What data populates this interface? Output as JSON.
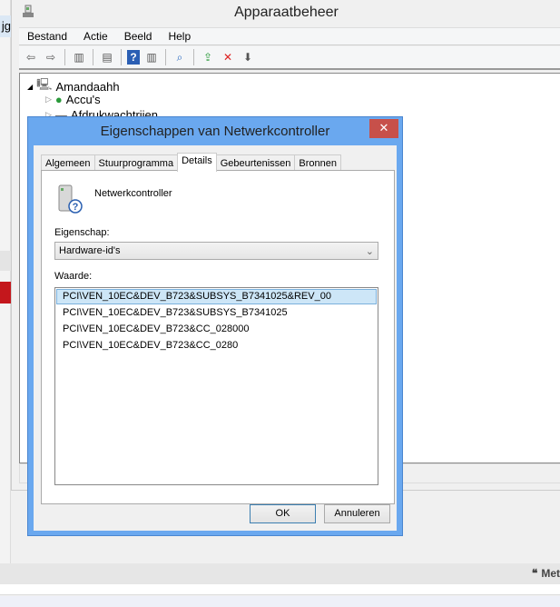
{
  "background": {
    "left_tab_text": "jg",
    "bottom_right_text": "Met"
  },
  "window": {
    "title": "Apparaatbeheer",
    "menu": [
      "Bestand",
      "Actie",
      "Beeld",
      "Help"
    ],
    "tree": {
      "root": "Amandaahh",
      "items": [
        "Accu's",
        "Afdrukwachtrijen"
      ]
    }
  },
  "dialog": {
    "title": "Eigenschappen van Netwerkcontroller",
    "close": "✕",
    "tabs": [
      "Algemeen",
      "Stuurprogramma",
      "Details",
      "Gebeurtenissen",
      "Bronnen"
    ],
    "active_tab": "Details",
    "device_name": "Netwerkcontroller",
    "property_label": "Eigenschap:",
    "property_value": "Hardware-id's",
    "value_label": "Waarde:",
    "values": [
      "PCI\\VEN_10EC&DEV_B723&SUBSYS_B7341025&REV_00",
      "PCI\\VEN_10EC&DEV_B723&SUBSYS_B7341025",
      "PCI\\VEN_10EC&DEV_B723&CC_028000",
      "PCI\\VEN_10EC&DEV_B723&CC_0280"
    ],
    "ok": "OK",
    "cancel": "Annuleren"
  }
}
